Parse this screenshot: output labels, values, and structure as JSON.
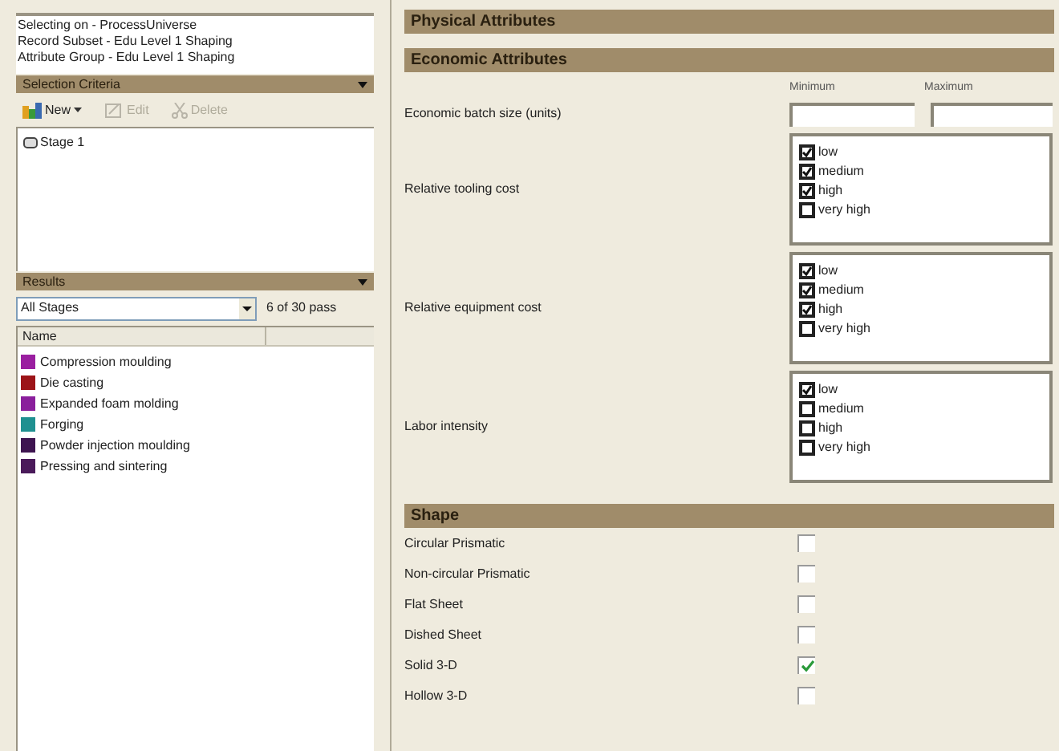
{
  "info": [
    "Selecting on - ProcessUniverse",
    "Record Subset - Edu Level 1 Shaping",
    "Attribute Group - Edu Level 1 Shaping"
  ],
  "selection_criteria": {
    "title": "Selection Criteria",
    "toolbar": [
      {
        "label": "New",
        "disabled": false,
        "kind": "new"
      },
      {
        "label": "Edit",
        "disabled": true,
        "kind": "edit"
      },
      {
        "label": "Delete",
        "disabled": true,
        "kind": "delete"
      }
    ],
    "items": [
      "Stage 1"
    ]
  },
  "results": {
    "title": "Results",
    "filter": "All Stages",
    "count": "6 of 30 pass",
    "columns": [
      "Name"
    ],
    "rows": [
      {
        "name": "Compression moulding",
        "color": "#9a1fa0"
      },
      {
        "name": "Die casting",
        "color": "#9c1418"
      },
      {
        "name": "Expanded foam molding",
        "color": "#8a1f9c"
      },
      {
        "name": "Forging",
        "color": "#1f9090"
      },
      {
        "name": "Powder injection moulding",
        "color": "#3e1450"
      },
      {
        "name": "Pressing and sintering",
        "color": "#4a1a5a"
      }
    ]
  },
  "sections": [
    {
      "title": "Physical Attributes"
    },
    {
      "title": "Economic Attributes",
      "range_headers": [
        "Minimum",
        "Maximum"
      ],
      "fields": [
        {
          "kind": "range",
          "label": "Economic batch size (units)"
        },
        {
          "kind": "checklist",
          "label": "Relative tooling cost",
          "options": [
            {
              "label": "low",
              "checked": true
            },
            {
              "label": "medium",
              "checked": true
            },
            {
              "label": "high",
              "checked": true
            },
            {
              "label": "very high",
              "checked": false
            }
          ]
        },
        {
          "kind": "checklist",
          "label": "Relative equipment cost",
          "options": [
            {
              "label": "low",
              "checked": true
            },
            {
              "label": "medium",
              "checked": true
            },
            {
              "label": "high",
              "checked": true
            },
            {
              "label": "very high",
              "checked": false
            }
          ]
        },
        {
          "kind": "checklist",
          "label": "Labor intensity",
          "options": [
            {
              "label": "low",
              "checked": true
            },
            {
              "label": "medium",
              "checked": false
            },
            {
              "label": "high",
              "checked": false
            },
            {
              "label": "very high",
              "checked": false
            }
          ]
        }
      ]
    },
    {
      "title": "Shape",
      "fields": [
        {
          "kind": "check",
          "label": "Circular Prismatic",
          "checked": false
        },
        {
          "kind": "check",
          "label": "Non-circular Prismatic",
          "checked": false
        },
        {
          "kind": "check",
          "label": "Flat Sheet",
          "checked": false
        },
        {
          "kind": "check",
          "label": "Dished Sheet",
          "checked": false
        },
        {
          "kind": "check",
          "label": "Solid 3-D",
          "checked": true
        },
        {
          "kind": "check",
          "label": "Hollow 3-D",
          "checked": false
        }
      ]
    }
  ]
}
